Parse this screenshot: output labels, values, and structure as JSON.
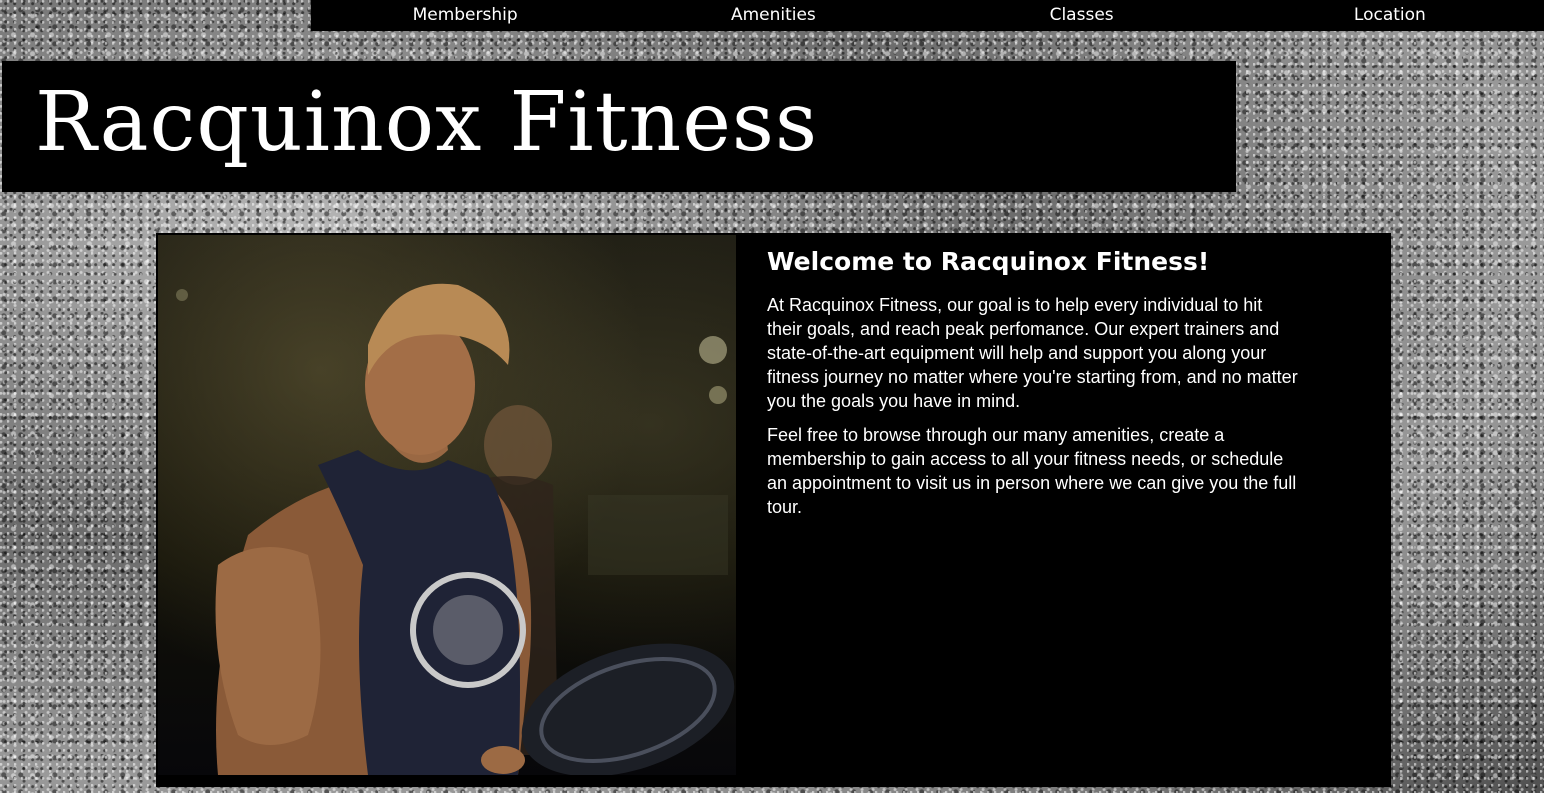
{
  "nav": {
    "items": [
      "Membership",
      "Amenities",
      "Classes",
      "Location"
    ]
  },
  "header": {
    "title": "Racquinox Fitness"
  },
  "main": {
    "image_alt": "Athlete lifting weights in a gym",
    "heading": "Welcome to Racquinox Fitness!",
    "paragraphs": [
      "At Racquinox Fitness, our goal is to help every individual to hit their goals, and reach peak perfomance. Our expert trainers and state-of-the-art equipment will help and support you along your fitness journey no matter where you're starting from, and no matter you the goals you have in mind.",
      "Feel free to browse through our many amenities, create a membership to gain access to all your fitness needs, or schedule an appointment to visit us in person where we can give you the full tour."
    ]
  },
  "colors": {
    "panel": "#000000",
    "text": "#ffffff"
  }
}
